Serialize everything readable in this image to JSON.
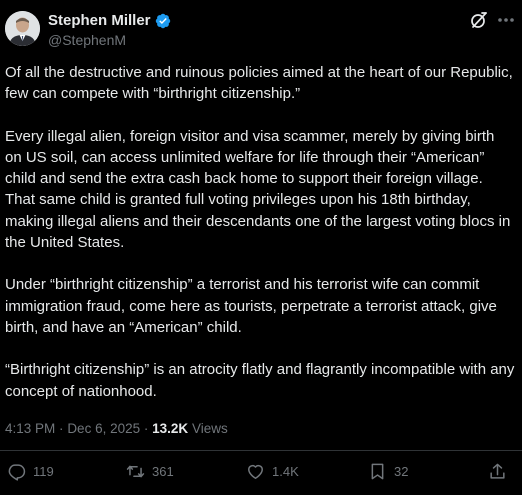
{
  "colors": {
    "background": "#000000",
    "text": "#e7e9ea",
    "secondary_text": "#71767b",
    "verified_badge": "#1d9bf0",
    "divider": "#2f3336"
  },
  "author": {
    "display_name": "Stephen Miller",
    "handle": "@StephenM",
    "verified": true,
    "avatar_icon": "profile-photo"
  },
  "post": {
    "paragraphs": [
      "Of all the destructive and ruinous policies aimed at the heart of our Republic, few can compete with “birthright citizenship.”",
      "Every illegal alien, foreign visitor and visa scammer, merely by giving birth on US soil, can access unlimited welfare for life through their “American” child and send the extra cash back home to support their foreign village. That same child is granted full voting privileges upon his 18th birthday, making illegal aliens and their descendants one of the largest voting blocs in the United States.",
      "Under “birthright citizenship” a terrorist and his terrorist wife can commit immigration fraud, come here as tourists, perpetrate a terrorist attack, give birth, and have an “American” child.",
      "“Birthright citizenship” is an atrocity flatly and flagrantly incompatible with any concept of nationhood."
    ],
    "time": "4:13 PM",
    "separator": "·",
    "date": "Dec 6, 2025",
    "views_count": "13.2K",
    "views_label": "Views"
  },
  "actions": {
    "reply": {
      "count": "119",
      "icon": "reply-icon"
    },
    "repost": {
      "count": "361",
      "icon": "repost-icon"
    },
    "like": {
      "count": "1.4K",
      "icon": "heart-icon"
    },
    "bookmark": {
      "count": "32",
      "icon": "bookmark-icon"
    },
    "share": {
      "icon": "share-icon"
    }
  },
  "header_icons": {
    "grok": "grok-icon",
    "more": "more-icon"
  }
}
